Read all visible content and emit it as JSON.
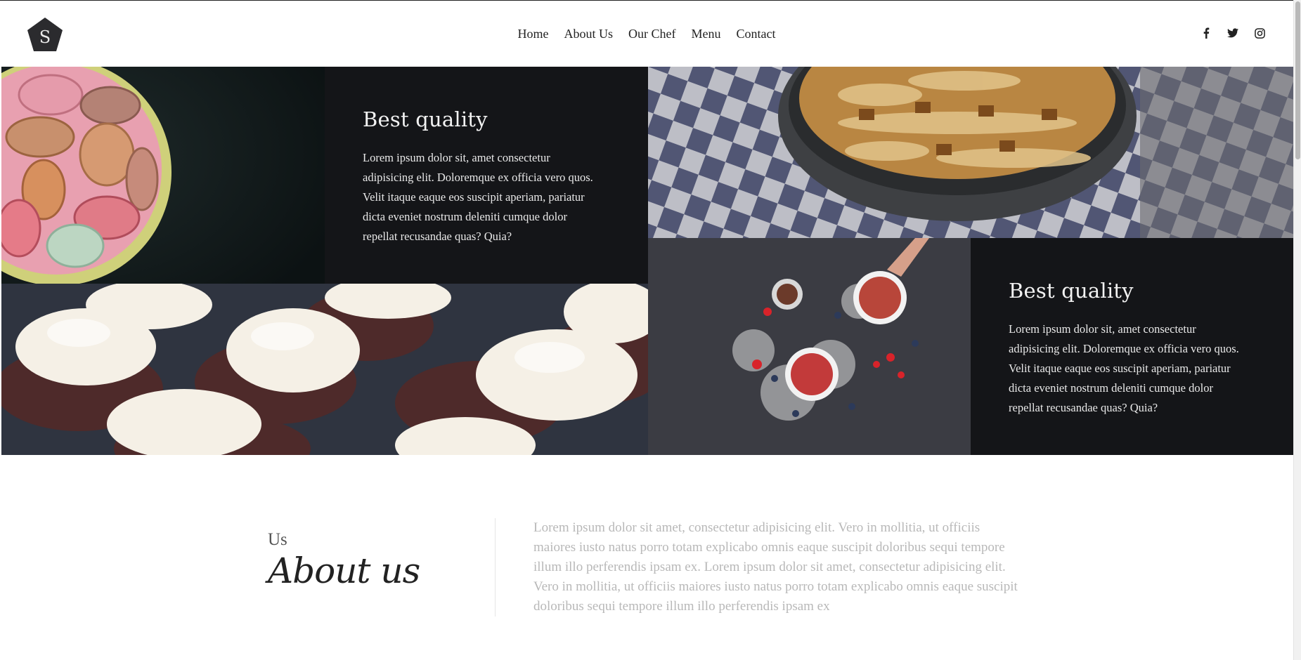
{
  "nav": {
    "items": [
      {
        "label": "Home"
      },
      {
        "label": "About Us"
      },
      {
        "label": "Our Chef"
      },
      {
        "label": "Menu"
      },
      {
        "label": "Contact"
      }
    ]
  },
  "logo": {
    "letter": "S"
  },
  "social": [
    {
      "icon": "facebook-icon"
    },
    {
      "icon": "twitter-icon"
    },
    {
      "icon": "instagram-icon"
    }
  ],
  "features": [
    {
      "title": "Best quality",
      "text": "Lorem ipsum dolor sit, amet consectetur adipisicing elit. Doloremque ex officia vero quos. Velit itaque eaque eos suscipit aperiam, pariatur dicta eveniet nostrum deleniti cumque dolor repellat recusandae quas? Quia?"
    },
    {
      "title": "Best quality",
      "text": "Lorem ipsum dolor sit, amet consectetur adipisicing elit. Doloremque ex officia vero quos. Velit itaque eaque eos suscipit aperiam, pariatur dicta eveniet nostrum deleniti cumque dolor repellat recusandae quas? Quia?"
    }
  ],
  "about": {
    "small": "Us",
    "title": "About us",
    "text": "Lorem ipsum dolor sit amet, consectetur adipisicing elit. Vero in mollitia, ut officiis maiores iusto natus porro totam explicabo omnis eaque suscipit doloribus sequi tempore illum illo perferendis ipsam ex. Lorem ipsum dolor sit amet, consectetur adipisicing elit. Vero in mollitia, ut officiis maiores iusto natus porro totam explicabo omnis eaque suscipit doloribus sequi tempore illum illo perferendis ipsam ex"
  },
  "colors": {
    "dark_panel": "#141518",
    "text_light": "#f2f2f2",
    "muted_text": "#b8b8b8"
  }
}
